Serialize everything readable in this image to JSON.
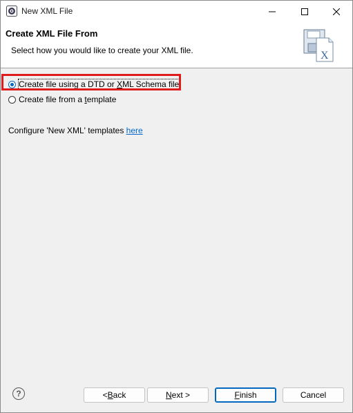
{
  "window": {
    "title": "New XML File"
  },
  "header": {
    "title": "Create XML File From",
    "description": "Select how you would like to create your XML file."
  },
  "options": [
    {
      "label_pre": "Create file using a DTD or ",
      "label_mnemonic": "X",
      "label_post": "ML Schema file",
      "selected": true
    },
    {
      "label_pre": "Create file from a ",
      "label_mnemonic": "t",
      "label_post": "emplate",
      "selected": false
    }
  ],
  "configure": {
    "text": "Configure 'New XML' templates ",
    "link": "here"
  },
  "buttons": {
    "help": "?",
    "back_pre": "< ",
    "back_mnemonic": "B",
    "back_post": "ack",
    "next_mnemonic": "N",
    "next_post": "ext >",
    "finish_mnemonic": "F",
    "finish_post": "inish",
    "cancel": "Cancel"
  },
  "colors": {
    "accent": "#0067c0",
    "highlight": "#e11b1b",
    "link": "#0066cc"
  }
}
